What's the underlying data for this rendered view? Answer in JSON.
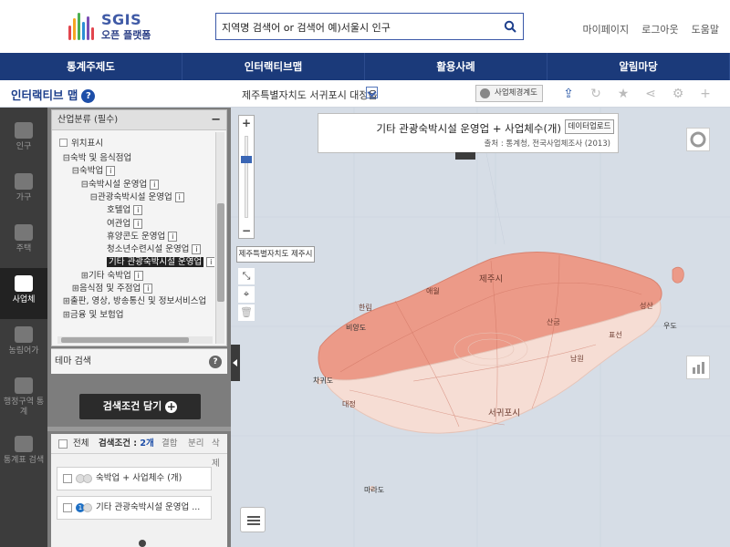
{
  "header": {
    "logo_title": "SGIS",
    "logo_subtitle": "오픈 플랫폼",
    "search_placeholder": "지역명 검색어 or 검색어 예)서울시 인구",
    "links": [
      "마이페이지",
      "로그아웃",
      "도움말"
    ]
  },
  "nav": [
    "통계주제도",
    "인터랙티브맵",
    "활용사례",
    "알림마당"
  ],
  "subbar": {
    "title": "인터랙티브 맵",
    "help": "?",
    "location": "제주특별자치도 서귀포시 대정읍",
    "boundary_button": "사업체경계도",
    "tools": [
      "upload-icon",
      "refresh-icon",
      "star-icon",
      "share-icon",
      "gear-icon",
      "plus-icon"
    ]
  },
  "leftbar": [
    {
      "label": "인구",
      "active": false
    },
    {
      "label": "가구",
      "active": false
    },
    {
      "label": "주택",
      "active": false
    },
    {
      "label": "사업체",
      "active": true
    },
    {
      "label": "농림어가",
      "active": false
    },
    {
      "label": "행정구역 통계",
      "active": false
    },
    {
      "label": "통계표 검색",
      "active": false
    }
  ],
  "tree": {
    "header": "산업분류 (필수)",
    "position_option": "위치표시",
    "items": [
      {
        "toggle": "⊟",
        "label": "숙박 및 음식점업",
        "info": false,
        "selected": false
      },
      {
        "toggle": "⊟",
        "label": "숙박업",
        "info": true,
        "selected": false
      },
      {
        "toggle": "⊟",
        "label": "숙박시설 운영업",
        "info": true,
        "selected": false
      },
      {
        "toggle": "⊟",
        "label": "관광숙박시설 운영업",
        "info": true,
        "selected": false
      },
      {
        "toggle": "",
        "label": "호텔업",
        "info": true,
        "selected": false
      },
      {
        "toggle": "",
        "label": "여관업",
        "info": true,
        "selected": false
      },
      {
        "toggle": "",
        "label": "휴양콘도 운영업",
        "info": true,
        "selected": false
      },
      {
        "toggle": "",
        "label": "청소년수련시설 운영업",
        "info": true,
        "selected": false
      },
      {
        "toggle": "",
        "label": "기타 관광숙박시설 운영업",
        "info": true,
        "selected": true
      },
      {
        "toggle": "⊞",
        "label": "기타 숙박업",
        "info": true,
        "selected": false
      },
      {
        "toggle": "⊞",
        "label": "음식점 및 주점업",
        "info": true,
        "selected": false
      },
      {
        "toggle": "⊞",
        "label": "출판, 영상, 방송통신 및 정보서비스업",
        "info": false,
        "selected": false
      },
      {
        "toggle": "⊞",
        "label": "금융 및 보험업",
        "info": false,
        "selected": false
      }
    ],
    "info_glyph": "i",
    "collapse": "−"
  },
  "theme_search": {
    "label": "테마 검색",
    "help": "?"
  },
  "condition_button": {
    "label": "검색조건 담기",
    "plus": "+"
  },
  "conditions": {
    "all_label": "전체",
    "label": "검색조건 : ",
    "count": "2개",
    "actions": [
      "결합",
      "분리",
      "삭제"
    ],
    "items": [
      {
        "label": "숙박업 + 사업체수 (개)",
        "color": "#e8e8e8"
      },
      {
        "label": "기타 관광숙박시설 운영업 ...",
        "color": "#1d6fc4",
        "num": "1"
      }
    ]
  },
  "map": {
    "zoom_in": "+",
    "zoom_out": "−",
    "zoom_level_fraction": 0.8,
    "region_label": "제주특별자치도 제주시",
    "legend_title": "기타 관광숙박시설 운영업 + 사업체수(개)",
    "download": "데이터업로드",
    "source": "출처 : 통계청, 전국사업체조사 (2013)",
    "place_labels": [
      "제주시",
      "서귀포시",
      "한림",
      "애월",
      "성산",
      "대정",
      "비양도",
      "마라도",
      "차귀도",
      "우도",
      "산굼",
      "남원",
      "표선"
    ],
    "colors": {
      "north": "#ec9a88",
      "south": "#f6ddd4",
      "sea": "#d6dde6",
      "accent": "#1d3f8c"
    }
  }
}
